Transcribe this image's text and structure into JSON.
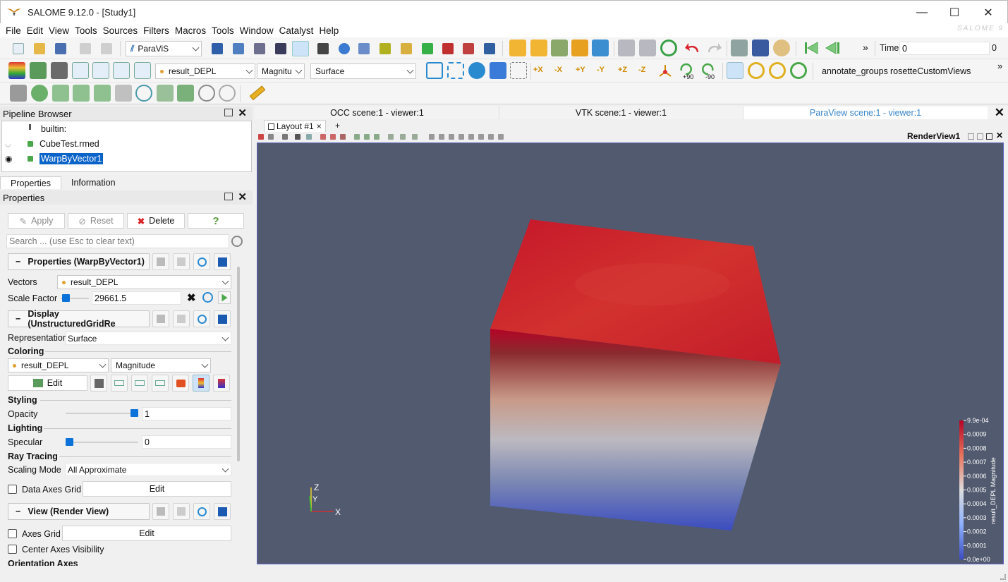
{
  "window": {
    "title": "SALOME 9.12.0 - [Study1]",
    "minimize": "—",
    "maximize": "☐",
    "close": "✕"
  },
  "menu": [
    "File",
    "Edit",
    "View",
    "Tools",
    "Sources",
    "Filters",
    "Macros",
    "Tools",
    "Window",
    "Catalyst",
    "Help"
  ],
  "brand_watermark": "SALOME 9",
  "toolbar": {
    "module_select": "ParaViS",
    "time_label": "Time:",
    "time_value": "0",
    "time_index": "0",
    "array_select": "result_DEPL",
    "component_select": "Magnitu",
    "representation_select": "Surface",
    "rotate_plus90": "+90",
    "rotate_minus90": "-90",
    "axis_labels": [
      "+X",
      "-X",
      "+Y",
      "-Y",
      "+Z",
      "-Z"
    ],
    "macro_annotate": "annotate_groups",
    "macro_rosette": "rosetteCustomViews",
    "overflow": "»"
  },
  "pipeline": {
    "title": "Pipeline Browser",
    "items": [
      "builtin:",
      "CubeTest.rmed",
      "WarpByVector1"
    ]
  },
  "tabs": {
    "properties": "Properties",
    "information": "Information"
  },
  "properties": {
    "title": "Properties",
    "apply": "Apply",
    "reset": "Reset",
    "delete": "Delete",
    "help": "?",
    "search_placeholder": "Search ... (use Esc to clear text)",
    "section_properties": "Properties (WarpByVector1)",
    "vectors_label": "Vectors",
    "vectors_value": "result_DEPL",
    "scale_factor_label": "Scale Factor",
    "scale_factor_value": "29661.5",
    "scale_factor_fraction": 0.08,
    "section_display": "Display (UnstructuredGridRe",
    "representation_label": "Representation",
    "representation_value": "Surface",
    "coloring_label": "Coloring",
    "coloring_array": "result_DEPL",
    "coloring_component": "Magnitude",
    "edit_label": "Edit",
    "styling_label": "Styling",
    "opacity_label": "Opacity",
    "opacity_value": "1",
    "opacity_fraction": 1.0,
    "lighting_label": "Lighting",
    "specular_label": "Specular",
    "specular_value": "0",
    "specular_fraction": 0.0,
    "raytracing_label": "Ray Tracing",
    "scaling_mode_label": "Scaling Mode",
    "scaling_mode_value": "All Approximate",
    "data_axes_grid_label": "Data Axes Grid",
    "data_axes_grid_edit": "Edit",
    "section_view": "View (Render View)",
    "axes_grid_label": "Axes Grid",
    "axes_grid_edit": "Edit",
    "center_axes_label": "Center Axes Visibility",
    "orientation_axes_label": "Orientation Axes"
  },
  "views": {
    "tabs": [
      "OCC scene:1 - viewer:1",
      "VTK scene:1 - viewer:1",
      "ParaView scene:1 - viewer:1"
    ],
    "layout_tab": "Layout #1",
    "layout_close": "×",
    "add_layout": "+",
    "render_view_name": "RenderView1"
  },
  "scene": {
    "axes": {
      "x": "X",
      "y": "Y",
      "z": "Z"
    },
    "colorbar": {
      "title": "result_DEPL Magnitude",
      "ticks": [
        "9.9e-04",
        "0.0009",
        "0.0008",
        "0.0007",
        "0.0006",
        "0.0005",
        "0.0004",
        "0.0003",
        "0.0002",
        "0.0001",
        "0.0e+00"
      ],
      "color_high": "#b40426",
      "color_mid": "#dddddd",
      "color_low": "#3b4cc0"
    }
  },
  "colors": {
    "background": "#525a6f",
    "accent": "#0a63c9",
    "active_tab_text": "#3a86c8"
  }
}
